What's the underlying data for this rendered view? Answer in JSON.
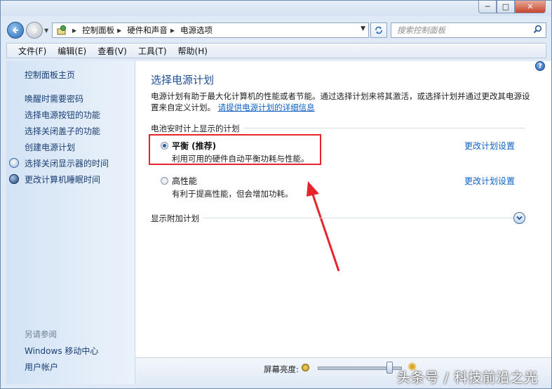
{
  "window": {
    "minimize": "─",
    "maximize": "□",
    "close": "✕"
  },
  "address": {
    "breadcrumbs": [
      "控制面板",
      "硬件和声音",
      "电源选项"
    ]
  },
  "search": {
    "placeholder": "搜索控制面板"
  },
  "menu": [
    "文件(F)",
    "编辑(E)",
    "查看(V)",
    "工具(T)",
    "帮助(H)"
  ],
  "sidebar": {
    "home": "控制面板主页",
    "links": [
      "唤醒时需要密码",
      "选择电源按钮的功能",
      "选择关闭盖子的功能",
      "创建电源计划",
      "选择关闭显示器的时间",
      "更改计算机睡眠时间"
    ],
    "see_also_header": "另请参阅",
    "see_also": [
      "Windows 移动中心",
      "用户帐户"
    ]
  },
  "main": {
    "title": "选择电源计划",
    "description": "电源计划有助于最大化计算机的性能或者节能。通过选择计划来将其激活，或选择计划并通过更改其电源设置来自定义计划。",
    "description_link": "请提供电源计划的详细信息",
    "section_label": "电池安时计上显示的计划",
    "plans": [
      {
        "name": "平衡 (推荐)",
        "description": "利用可用的硬件自动平衡功耗与性能。",
        "selected": true,
        "change_link": "更改计划设置"
      },
      {
        "name": "高性能",
        "description": "有利于提高性能，但会增加功耗。",
        "selected": false,
        "change_link": "更改计划设置"
      }
    ],
    "more_label": "显示附加计划"
  },
  "bottom": {
    "brightness_label": "屏幕亮度:",
    "brightness_level": 0.85
  },
  "watermark": "头条号 / 科技前沿之光",
  "colors": {
    "highlight_box": "#e5242b",
    "link": "#0e62c7",
    "title": "#1e4e95"
  }
}
